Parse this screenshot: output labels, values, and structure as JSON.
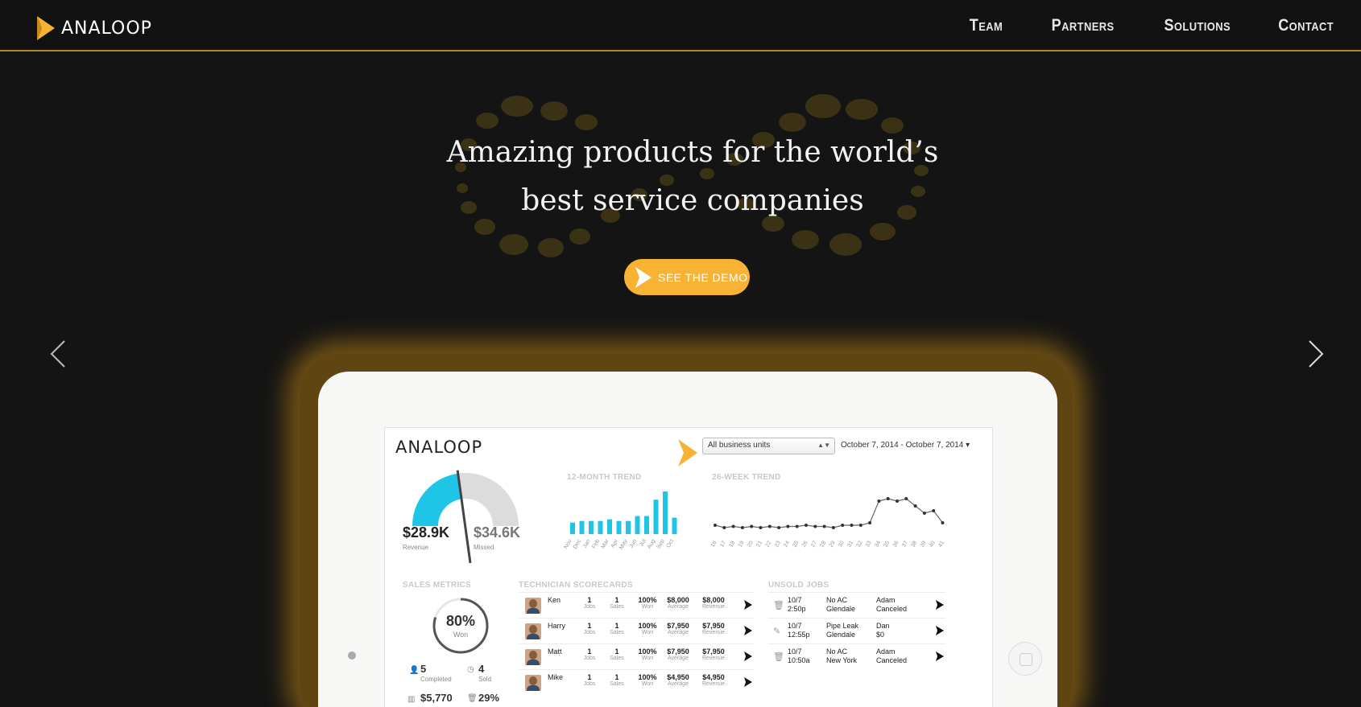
{
  "nav": {
    "brand": "ANALOOP",
    "links": [
      "Team",
      "Partners",
      "Solutions",
      "Contact"
    ]
  },
  "hero": {
    "title_line1": "Amazing products for the world’s",
    "title_line2": "best service companies",
    "cta": "SEE THE DEMO"
  },
  "colors": {
    "accent": "#f8b234",
    "background": "#141414",
    "cyan": "#1ec5e6"
  },
  "dashboard": {
    "brand": "ANALOOP",
    "business_units": "All business units",
    "date_range": "October 7, 2014 - October 7, 2014",
    "revenue_value": "$28.9K",
    "revenue_label": "Revenue",
    "missed_value": "$34.6K",
    "missed_label": "Missed",
    "gauge_fraction": 0.455,
    "trend12_title": "12-MONTH TREND",
    "trend12_months": [
      "Nov",
      "Dec",
      "Jan",
      "Feb",
      "Mar",
      "Apr",
      "May",
      "Jun",
      "Jul",
      "Aug",
      "Sep",
      "Oct"
    ],
    "trend12_values": [
      14,
      16,
      16,
      16,
      18,
      16,
      16,
      22,
      22,
      42,
      52,
      20
    ],
    "trend26_title": "26-WEEK TREND",
    "trend26_labels": [
      "16",
      "17",
      "18",
      "19",
      "20",
      "21",
      "22",
      "23",
      "24",
      "25",
      "26",
      "27",
      "28",
      "29",
      "30",
      "31",
      "32",
      "33",
      "34",
      "35",
      "36",
      "37",
      "38",
      "39",
      "40",
      "41"
    ],
    "trend26_values": [
      10,
      8,
      9,
      8,
      9,
      8,
      9,
      8,
      9,
      9,
      10,
      9,
      9,
      8,
      10,
      10,
      10,
      12,
      30,
      32,
      30,
      32,
      26,
      20,
      22,
      12
    ],
    "sales_metrics_title": "SALES METRICS",
    "won_pct": "80%",
    "won_fraction": 0.8,
    "won_label": "Won",
    "completed_value": "5",
    "completed_label": "Completed",
    "sold_value": "4",
    "sold_label": "Sold",
    "amount_value": "$5,770",
    "pct_value": "29%",
    "tech_title": "TECHNICIAN SCORECARDS",
    "technicians": [
      {
        "name": "Ken",
        "jobs": "1",
        "sales": "1",
        "won": "100%",
        "average": "$8,000",
        "revenue": "$8,000"
      },
      {
        "name": "Harry",
        "jobs": "1",
        "sales": "1",
        "won": "100%",
        "average": "$7,950",
        "revenue": "$7,950"
      },
      {
        "name": "Matt",
        "jobs": "1",
        "sales": "1",
        "won": "100%",
        "average": "$7,950",
        "revenue": "$7,950"
      },
      {
        "name": "Mike",
        "jobs": "1",
        "sales": "1",
        "won": "100%",
        "average": "$4,950",
        "revenue": "$4,950"
      }
    ],
    "tech_sub": {
      "jobs": "Jobs",
      "sales": "Sales",
      "won": "Won",
      "average": "Average",
      "revenue": "Revenue"
    },
    "unsold_title": "UNSOLD JOBS",
    "unsold": [
      {
        "date": "10/7",
        "time": "2:50p",
        "issue": "No AC",
        "location": "Glendale",
        "tech": "Adam",
        "status": "Canceled",
        "icon": "trash-icon"
      },
      {
        "date": "10/7",
        "time": "12:55p",
        "issue": "Pipe Leak",
        "location": "Glendale",
        "tech": "Dan",
        "status": "$0",
        "icon": "edit-icon"
      },
      {
        "date": "10/7",
        "time": "10:50a",
        "issue": "No AC",
        "location": "New York",
        "tech": "Adam",
        "status": "Canceled",
        "icon": "trash-icon"
      }
    ]
  }
}
